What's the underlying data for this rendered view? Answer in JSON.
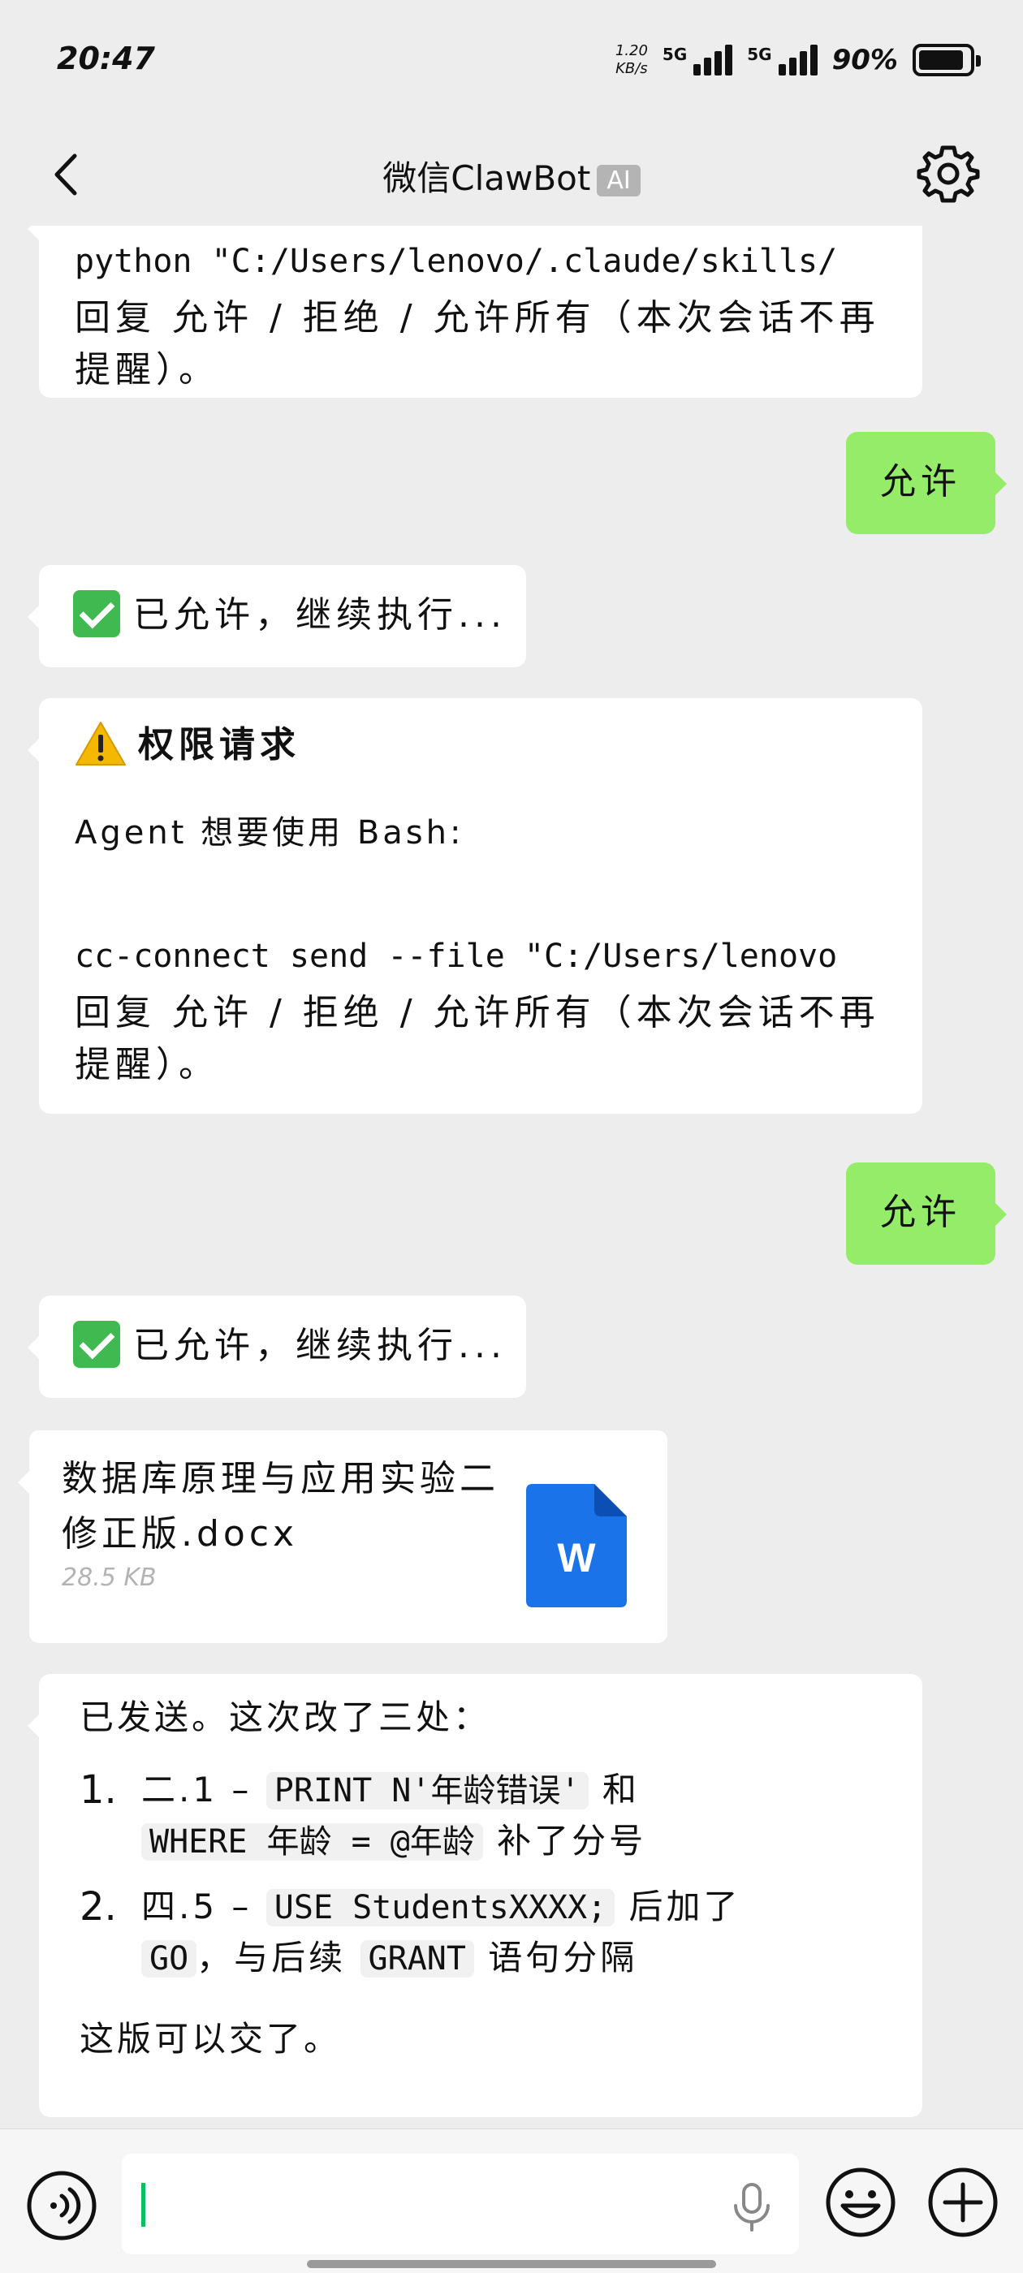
{
  "status_bar": {
    "time": "20:47",
    "speed_value": "1.20",
    "speed_unit": "KB/s",
    "network1": "5G",
    "network2": "5G",
    "battery_percent": "90%",
    "battery_level": 0.9
  },
  "header": {
    "title": "微信ClawBot",
    "badge": "AI"
  },
  "messages": {
    "m1": {
      "command": "python \"C:/Users/lenovo/.claude/skills/",
      "prompt": "回复 允许 / 拒绝 / 允许所有（本次会话不再提醒）。"
    },
    "m2": {
      "text": "允许"
    },
    "m3": {
      "text": "已允许，继续执行..."
    },
    "m4": {
      "title": "权限请求",
      "subtitle": "Agent 想要使用 Bash:",
      "command": "cc-connect send --file \"C:/Users/lenovo",
      "prompt": "回复 允许 / 拒绝 / 允许所有（本次会话不再提醒）。"
    },
    "m5": {
      "text": "允许"
    },
    "m6": {
      "text": "已允许，继续执行..."
    },
    "file": {
      "name": "数据库原理与应用实验二修正版.docx",
      "size": "28.5 KB",
      "icon_letter": "W"
    },
    "m7": {
      "intro": "已发送。这次改了三处：",
      "item1_num": "1.",
      "item1_a": "二.1 – ",
      "item1_code1": "PRINT N'年龄错误'",
      "item1_b": " 和",
      "item1_code2": "WHERE 年龄 = @年龄",
      "item1_c": " 补了分号",
      "item2_num": "2.",
      "item2_a": "四.5 – ",
      "item2_code1": "USE StudentsXXXX;",
      "item2_b": " 后加了",
      "item2_code2": "GO",
      "item2_c": "，与后续 ",
      "item2_code3": "GRANT",
      "item2_d": " 语句分隔",
      "outro": "这版可以交了。"
    }
  },
  "input": {
    "value": "",
    "placeholder": ""
  },
  "colors": {
    "background": "#ededed",
    "bubble_self": "#95ec69",
    "bubble_other": "#ffffff",
    "word_blue": "#1a73e8",
    "accent_green": "#07c160"
  }
}
